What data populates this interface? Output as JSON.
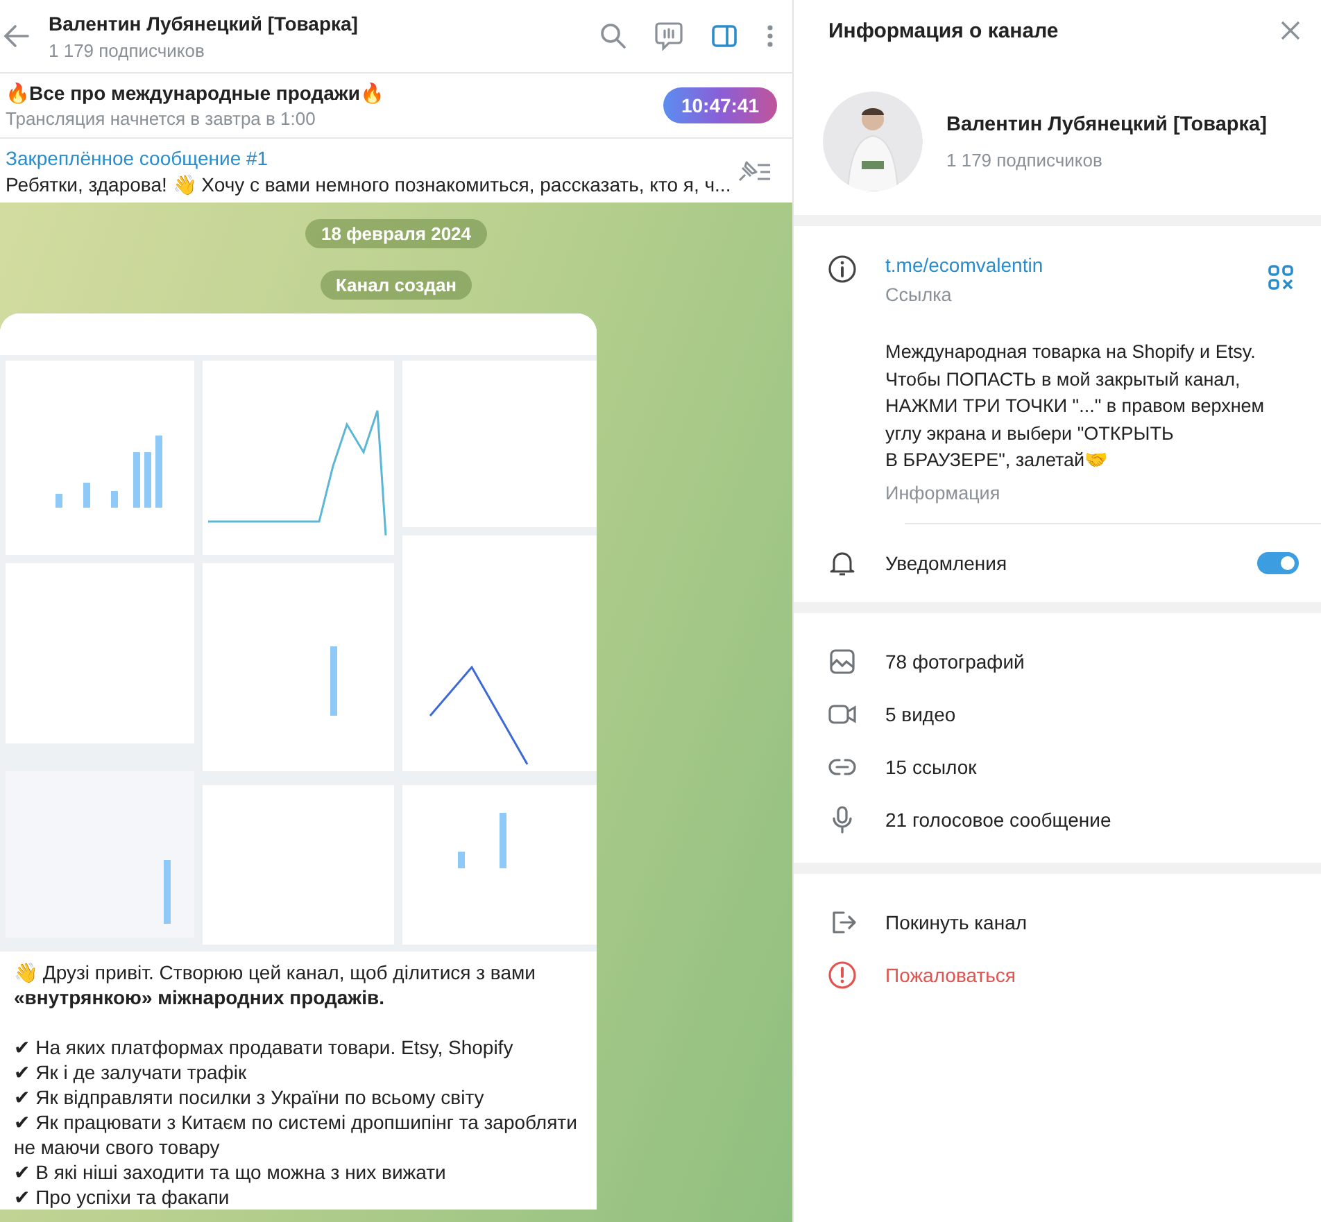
{
  "header": {
    "title": "Валентин Лубянецкий [Товарка]",
    "subtitle": "1 179 подписчиков"
  },
  "live": {
    "title": "🔥Все про международные продажи🔥",
    "subtitle": "Трансляция начнется в завтра в 1:00",
    "timer": "10:47:41"
  },
  "pinned": {
    "label": "Закреплённое сообщение #1",
    "text": "Ребятки, здарова! 👋 Хочу с вами немного познакомиться, рассказать, кто я, ч..."
  },
  "chat": {
    "service": [
      "18 февраля 2024",
      "Канал создан"
    ],
    "post": {
      "intro": "👋 Друзі привіт. Створюю цей канал, щоб ділитися з вами **«внутрянкою» міжнародних продажів.**",
      "items": [
        "✔ На яких платформах продавати товари. Etsy, Shopify",
        "✔ Як і де залучати трафік",
        "✔ Як відправляти посилки з України по всьому світу",
        "✔ Як працювати з Китаєм по системі дропшипінг та заробляти не маючи свого товару",
        "✔ В які ніші заходити та що можна з них вижати",
        "✔ Про успіхи та факапи"
      ]
    }
  },
  "info_panel": {
    "title": "Информация о канале",
    "name": "Валентин Лубянецкий [Товарка]",
    "subtitle": "1 179 подписчиков",
    "link": "t.me/ecomvalentin",
    "link_label": "Ссылка",
    "description": "Международная товарка на Shopify и Etsy. Чтобы ПОПАСТЬ в мой закрытый канал, НАЖМИ ТРИ ТОЧКИ \"...\" в правом верхнем углу экрана и выбери \"ОТКРЫТЬ\nВ БРАУЗЕРЕ\", залетай🤝",
    "description_label": "Информация",
    "notifications": {
      "label": "Уведомления",
      "on": true
    },
    "media": [
      {
        "kind": "photos",
        "label": "78 фотографий"
      },
      {
        "kind": "video",
        "label": "5 видео"
      },
      {
        "kind": "links",
        "label": "15 ссылок"
      },
      {
        "kind": "voice",
        "label": "21 голосовое сообщение"
      }
    ],
    "actions": [
      {
        "kind": "leave",
        "label": "Покинуть канал"
      },
      {
        "kind": "report",
        "label": "Пожаловаться"
      }
    ]
  }
}
